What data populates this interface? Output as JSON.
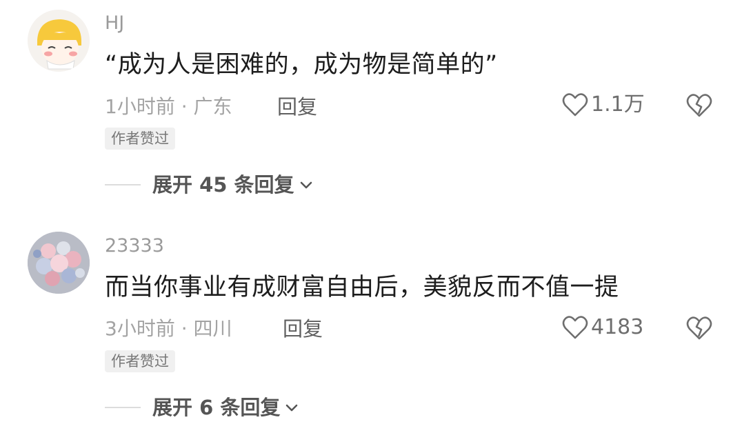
{
  "comments": [
    {
      "username": "HJ",
      "content": "“成为人是困难的，成为物是简单的”",
      "meta": "1小时前 · 广东",
      "reply_label": "回复",
      "like_count": "1.1万",
      "badge": "作者赞过",
      "expand_label": "展开 45 条回复",
      "avatar_icon": "cartoon-avatar-icon"
    },
    {
      "username": "23333",
      "content": "而当你事业有成财富自由后，美貌反而不值一提",
      "meta": "3小时前 · 四川",
      "reply_label": "回复",
      "like_count": "4183",
      "badge": "作者赞过",
      "expand_label": "展开 6 条回复",
      "avatar_icon": "flower-bouquet-avatar-icon"
    }
  ],
  "colors": {
    "text_primary": "#1d1d1d",
    "text_secondary": "#a3a3a3",
    "badge_bg": "#f0f0f0"
  }
}
